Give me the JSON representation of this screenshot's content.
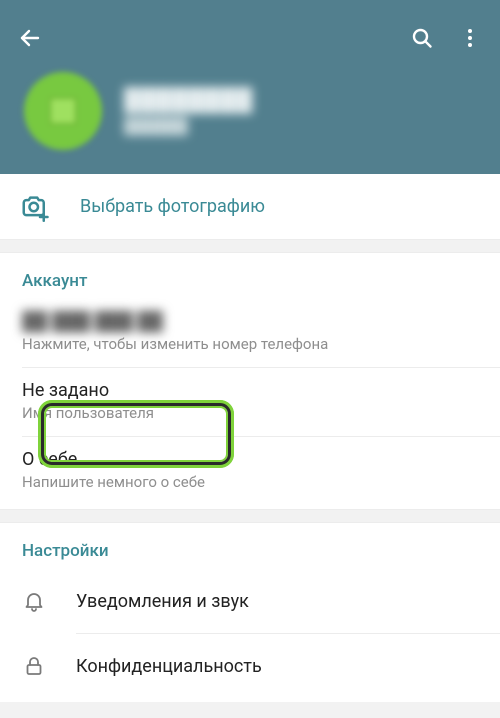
{
  "colors": {
    "header_bg": "#527f8e",
    "accent": "#3a8a95",
    "avatar": "#78c940"
  },
  "header": {
    "profile_name": "████████",
    "profile_status": "██████"
  },
  "photo": {
    "label": "Выбрать фотографию"
  },
  "account": {
    "header": "Аккаунт",
    "phone": {
      "value": "██ ███ ███ ██",
      "hint": "Нажмите, чтобы изменить номер телефона"
    },
    "username": {
      "value": "Не задано",
      "hint": "Имя пользователя"
    },
    "bio": {
      "value": "О себе",
      "hint": "Напишите немного о себе"
    }
  },
  "settings": {
    "header": "Настройки",
    "items": [
      {
        "label": "Уведомления и звук",
        "icon": "bell"
      },
      {
        "label": "Конфиденциальность",
        "icon": "lock"
      }
    ]
  }
}
